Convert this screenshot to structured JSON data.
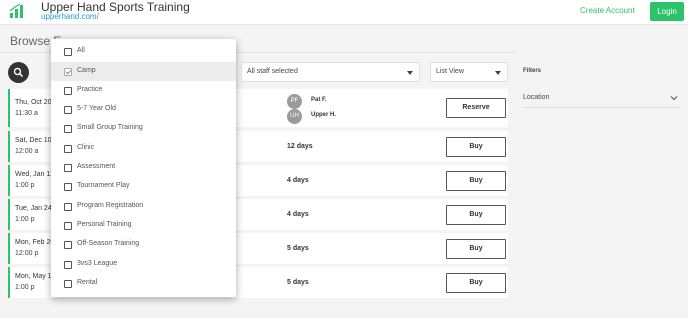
{
  "header": {
    "title": "Upper Hand Sports Training",
    "url": "upperhand.com/",
    "create_account": "Create Account",
    "login": "Login",
    "accent": "#2cc36b"
  },
  "browse": {
    "title": "Browse E"
  },
  "search": {
    "icon": "search-icon"
  },
  "staff_filter": {
    "value": "All staff selected"
  },
  "view_filter": {
    "value": "List View"
  },
  "filters": {
    "label": "Filters",
    "location_label": "Location"
  },
  "cards": [
    {
      "date": "Thu, Oct 20",
      "time": "11:30 a",
      "button": "Reserve",
      "staff": [
        {
          "initials": "PF",
          "name": "Pat F."
        },
        {
          "initials": "UH",
          "name": "Upper H."
        }
      ]
    },
    {
      "date": "Sat, Dec 10",
      "time": "12:00 a",
      "days": "12 days",
      "button": "Buy"
    },
    {
      "date": "Wed, Jan 11",
      "time": "1:00 p",
      "days": "4 days",
      "button": "Buy"
    },
    {
      "date": "Tue, Jan 24",
      "time": "1:00 p",
      "days": "4 days",
      "button": "Buy"
    },
    {
      "date": "Mon, Feb 20",
      "time": "12:00 p",
      "days": "5 days",
      "button": "Buy"
    },
    {
      "date": "Mon, May 15",
      "time": "1:00 p",
      "days": "5 days",
      "button": "Buy"
    }
  ],
  "dropdown": {
    "items": [
      {
        "label": "All",
        "checked": false
      },
      {
        "label": "Camp",
        "checked": true
      },
      {
        "label": "Practice",
        "checked": false
      },
      {
        "label": "5-7 Year Old",
        "checked": false
      },
      {
        "label": "Small Group Training",
        "checked": false
      },
      {
        "label": "Clinic",
        "checked": false
      },
      {
        "label": "Assessment",
        "checked": false
      },
      {
        "label": "Tournament Play",
        "checked": false
      },
      {
        "label": "Program Registration",
        "checked": false
      },
      {
        "label": "Personal Training",
        "checked": false
      },
      {
        "label": "Off-Season Training",
        "checked": false
      },
      {
        "label": "3vs3 League",
        "checked": false
      },
      {
        "label": "Rental",
        "checked": false
      }
    ]
  }
}
